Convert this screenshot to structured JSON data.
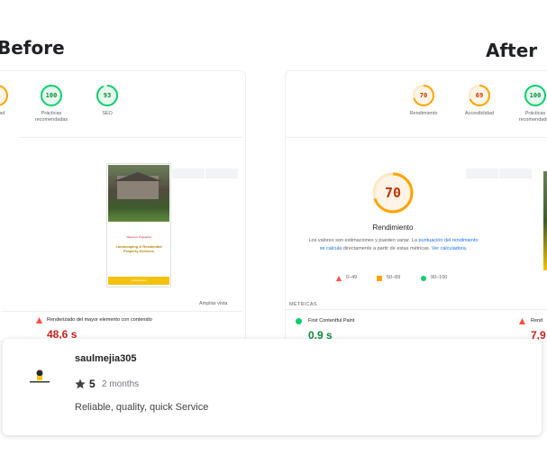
{
  "headings": {
    "before": "Before",
    "after": "After"
  },
  "before_panel": {
    "top_gauges": [
      {
        "value": "100",
        "label": "Prácticas recomendadas",
        "color": "#0cce6b"
      },
      {
        "value": "93",
        "label": "SEO",
        "color": "#0cce6b"
      }
    ],
    "partial_label": "idad",
    "thumbnail": {
      "banner_text": "Mejora tu Propiedad",
      "headline": "Landscaping & Residential Property Services",
      "button_label": "Contáctanos",
      "bg": "#2f3e24",
      "accent": "#f4c20d"
    },
    "view_link": "Ampliar vista",
    "metric": {
      "label": "Renderizado del mayor elemento con contenido",
      "value": "48,6 s",
      "status": "poor"
    }
  },
  "after_panel": {
    "top_gauges": [
      {
        "value": "70",
        "label": "Rendimiento",
        "color": "#ffa400"
      },
      {
        "value": "69",
        "label": "Accesibilidad",
        "color": "#ffa400"
      },
      {
        "value": "100",
        "label": "Prácticas recomendadas",
        "color": "#0cce6b"
      }
    ],
    "main_score": {
      "value": "70",
      "label": "Rendimiento",
      "color": "#ffa400",
      "fraction": 0.7
    },
    "description_plain": "Los valores son estimaciones y pueden variar. La",
    "description_link": "puntuación del rendimiento se calcula",
    "description_plain_2": "directamente a partir de estas métricas.",
    "description_link_2": "Ver calculadora.",
    "legend": [
      {
        "range": "0–49",
        "color": "#ff4e42",
        "shape": "triangle"
      },
      {
        "range": "50–89",
        "color": "#ffa400",
        "shape": "square"
      },
      {
        "range": "90–100",
        "color": "#0cce6b",
        "shape": "circle"
      }
    ],
    "metrics_header": "MÉTRICAS",
    "metric": {
      "label": "First Contentful Paint",
      "value": "0.9 s",
      "status": "good"
    },
    "partial_metric_label": "Rend",
    "partial_metric_value": "7,9"
  },
  "review": {
    "username": "saulmejia305",
    "rating": "5",
    "time_ago": "2 months",
    "text": "Reliable, quality, quick Service",
    "star_icon": "star-icon"
  }
}
